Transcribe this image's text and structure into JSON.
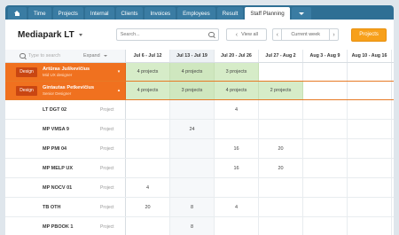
{
  "nav": {
    "tabs": [
      "Time",
      "Projects",
      "Internal",
      "Clients",
      "Invoices",
      "Employees",
      "Result"
    ],
    "active_tab": "Staff Planning"
  },
  "toolbar": {
    "company": "Mediapark LT",
    "search_placeholder": "Search...",
    "view_all": "View all",
    "current_week": "Current week",
    "projects_button": "Projects"
  },
  "grid": {
    "filter_placeholder": "Type to search",
    "expand_label": "Expand",
    "weeks": [
      "Jul 6 - Jul 12",
      "Jul 13 - Jul 19",
      "Jul 20 - Jul 26",
      "Jul 27 - Aug 2",
      "Aug 3 - Aug 9",
      "Aug 10 - Aug 16"
    ],
    "people": [
      {
        "badge": "Design",
        "name": "Artūras Juškevičius",
        "role": "Mid UX designer",
        "chevron": "▾",
        "weeks": [
          "4 projects",
          "4 projects",
          "3 projects",
          "",
          "",
          ""
        ]
      },
      {
        "badge": "Design",
        "name": "Gintautas Petkevičius",
        "role": "Senior Designer",
        "chevron": "▴",
        "weeks": [
          "4 projects",
          "3 projects",
          "4 projects",
          "2 projects",
          "",
          ""
        ]
      }
    ],
    "projects": [
      {
        "code": "LT DGT 02",
        "type": "Project",
        "weeks": [
          "",
          "",
          "4",
          "",
          "",
          ""
        ]
      },
      {
        "code": "MP VMSA 9",
        "type": "Project",
        "weeks": [
          "",
          "24",
          "",
          "",
          "",
          ""
        ]
      },
      {
        "code": "MP PMI 04",
        "type": "Project",
        "weeks": [
          "",
          "",
          "16",
          "20",
          "",
          ""
        ]
      },
      {
        "code": "MP MELP UX",
        "type": "Project",
        "weeks": [
          "",
          "",
          "16",
          "20",
          "",
          ""
        ]
      },
      {
        "code": "MP NOCV 01",
        "type": "Project",
        "weeks": [
          "4",
          "",
          "",
          "",
          "",
          ""
        ]
      },
      {
        "code": "TB OTH",
        "type": "Project",
        "weeks": [
          "20",
          "8",
          "4",
          "",
          "",
          ""
        ]
      },
      {
        "code": "MP PBOOK 1",
        "type": "Project",
        "weeks": [
          "",
          "8",
          "",
          "",
          "",
          ""
        ]
      }
    ]
  },
  "colors": {
    "nav": "#2f6f94",
    "person_row": "#f0711f",
    "badge": "#c94612",
    "allocated": "#d6ecc8",
    "primary_button": "#f7a01b"
  },
  "icons": [
    "home-icon",
    "more-dropdown-icon",
    "search-icon",
    "chevron-left-icon",
    "chevron-right-icon",
    "expand-dropdown-icon"
  ]
}
